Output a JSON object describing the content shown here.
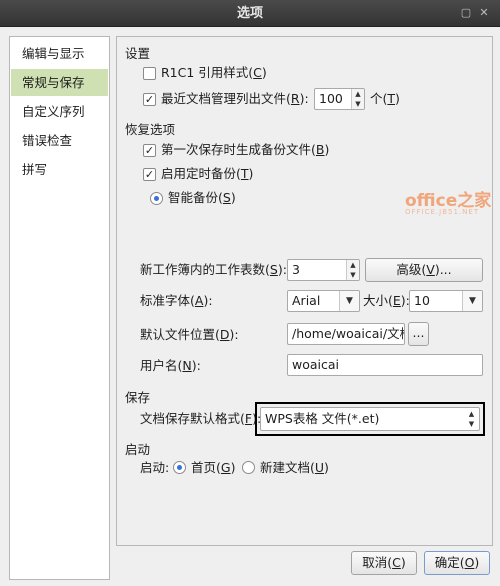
{
  "window": {
    "title": "选项"
  },
  "nav": {
    "items": [
      "编辑与显示",
      "常规与保存",
      "自定义序列",
      "错误检查",
      "拼写"
    ],
    "active_index": 1
  },
  "settings": {
    "section": "设置",
    "r1c1": {
      "label": "R1C1 引用样式(",
      "key": "C",
      "suffix": ")",
      "checked": false
    },
    "recent": {
      "label": "最近文档管理列出文件(",
      "key": "R",
      "suffix": "):",
      "value": "100",
      "unit_label": "个(",
      "unit_key": "T",
      "unit_suffix": ")",
      "checked": true
    }
  },
  "recovery": {
    "section": "恢复选项",
    "backup_first": {
      "label": "第一次保存时生成备份文件(",
      "key": "B",
      "suffix": ")",
      "checked": true
    },
    "timed_backup": {
      "label": "启用定时备份(",
      "key": "T",
      "suffix": ")",
      "checked": true
    },
    "smart_backup": {
      "label": "智能备份(",
      "key": "S",
      "suffix": ")",
      "selected": true
    }
  },
  "watermark": {
    "brand": "office之家",
    "site": "OFFICE.JB51.NET"
  },
  "general": {
    "sheets": {
      "label": "新工作簿内的工作表数(",
      "key": "S",
      "suffix": "):",
      "value": "3"
    },
    "advanced": {
      "label": "高级(",
      "key": "V",
      "suffix": ")..."
    },
    "std_font": {
      "label": "标准字体(",
      "key": "A",
      "suffix": "):",
      "value": "Arial"
    },
    "size": {
      "label": "大小(",
      "key": "E",
      "suffix": "):",
      "value": "10"
    },
    "file_loc": {
      "label": "默认文件位置(",
      "key": "D",
      "suffix": "):",
      "value": "/home/woaicai/文档",
      "browse": "..."
    },
    "username": {
      "label": "用户名(",
      "key": "N",
      "suffix": "):",
      "value": "woaicai"
    }
  },
  "save": {
    "section": "保存",
    "format": {
      "label": "文档保存默认格式(",
      "key": "F",
      "suffix": "):",
      "value": "WPS表格 文件(*.et)"
    }
  },
  "startup": {
    "section": "启动",
    "label": "启动:",
    "home": {
      "label": "首页(",
      "key": "G",
      "suffix": ")",
      "selected": true
    },
    "new_doc": {
      "label": "新建文档(",
      "key": "U",
      "suffix": ")",
      "selected": false
    }
  },
  "footer": {
    "cancel": {
      "label": "取消(",
      "key": "C",
      "suffix": ")"
    },
    "ok": {
      "label": "确定(",
      "key": "O",
      "suffix": ")"
    }
  },
  "colors": {
    "nav_active": "#cfe0b3",
    "titlebar": "#3b3b3b",
    "highlight_border": "#000000"
  }
}
